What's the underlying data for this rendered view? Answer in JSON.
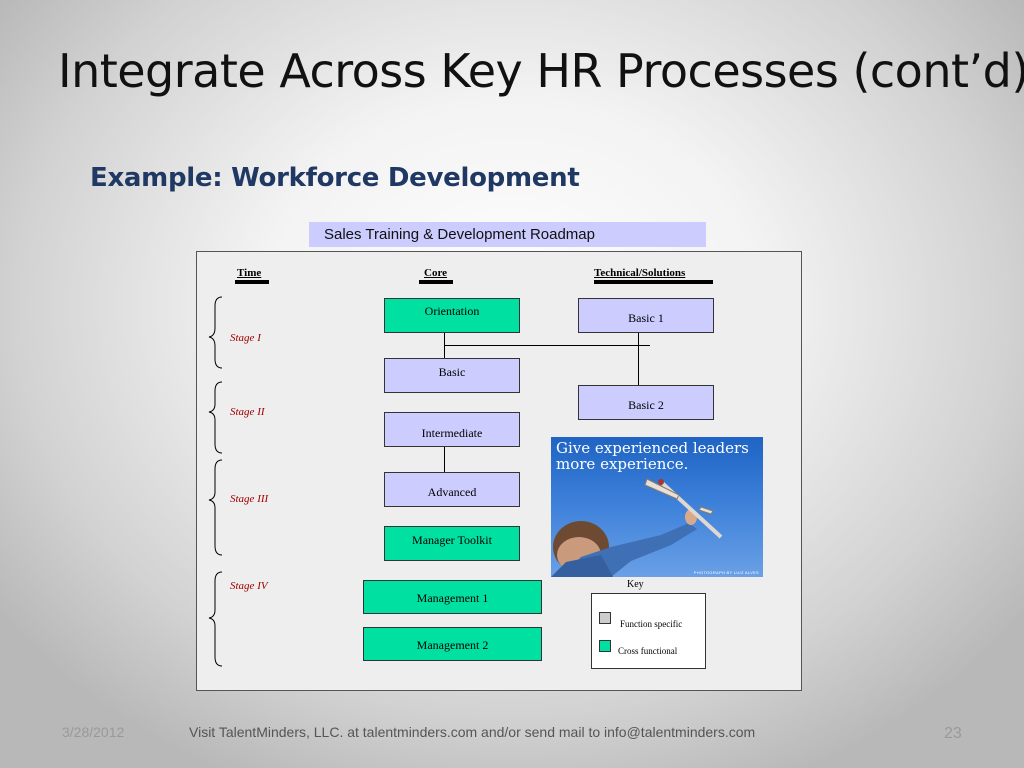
{
  "slide": {
    "title": "Integrate Across Key HR Processes (cont’d)",
    "subtitle": "Example: Workforce Development"
  },
  "diagram": {
    "banner": "Sales Training & Development Roadmap",
    "columns": {
      "time": "Time",
      "core": "Core",
      "technical": "Technical/Solutions"
    },
    "stages": [
      "Stage I",
      "Stage II",
      "Stage III",
      "Stage IV"
    ],
    "core_boxes": [
      "Orientation",
      "Basic",
      "Intermediate",
      "Advanced",
      "Manager Toolkit",
      "Management 1",
      "Management 2"
    ],
    "technical_boxes": [
      "Basic 1",
      "Basic 2"
    ],
    "photo": {
      "caption_line1": "Give experienced leaders",
      "caption_line2": "more experience.",
      "credit": "PHOTOGRAPH BY LUIZ ALVES"
    },
    "key": {
      "title": "Key",
      "items": [
        "Function specific",
        "Cross functional"
      ]
    },
    "colors": {
      "cross_functional": "#00e0a0",
      "function_specific": "#ccccff",
      "stage_text": "#a00000"
    }
  },
  "footer": {
    "date": "3/28/2012",
    "contact": "Visit TalentMinders, LLC. at talentminders.com and/or send mail to info@talentminders.com",
    "page_number": "23"
  }
}
